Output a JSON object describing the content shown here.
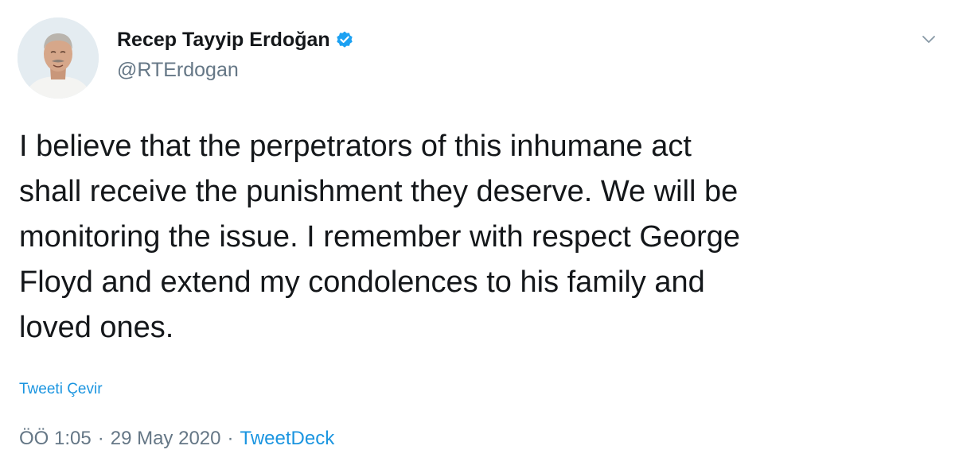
{
  "author": {
    "display_name": "Recep Tayyip Erdoğan",
    "handle": "@RTErdogan",
    "verified": true
  },
  "tweet": {
    "text": "I believe that the perpetrators of this inhumane act\nshall receive the punishment they deserve. We will be\nmonitoring the issue. I remember with respect George\nFloyd and extend my condolences to his family and\nloved ones.",
    "translate_label": "Tweeti Çevir",
    "time": "ÖÖ 1:05",
    "date": "29 May 2020",
    "separator": "·",
    "source": "TweetDeck"
  },
  "icons": {
    "verified": "verified-badge-icon",
    "menu": "chevron-down-icon"
  },
  "colors": {
    "text": "#14171a",
    "secondary": "#657786",
    "link": "#1b95e0",
    "verified": "#1da1f2"
  }
}
